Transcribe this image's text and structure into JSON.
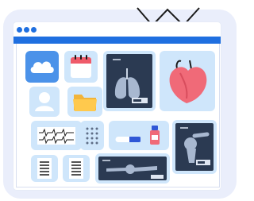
{
  "illustration": {
    "theme": "medical records dashboard",
    "icons": [
      "cloud-icon",
      "calendar-icon",
      "lungs-xray-icon",
      "heart-icon",
      "user-icon",
      "folder-icon",
      "ecg-icon",
      "keypad-icon",
      "pill-icon",
      "medicine-bottle-icon",
      "shoulder-xray-icon",
      "document-icon",
      "knee-xray-icon"
    ]
  },
  "colors": {
    "background_blob": "#eaeefb",
    "window_blue": "#1f6fe0",
    "tile_blue": "#cfe6fb",
    "xray_dark": "#2b3a52",
    "heart_red": "#f06a78"
  }
}
